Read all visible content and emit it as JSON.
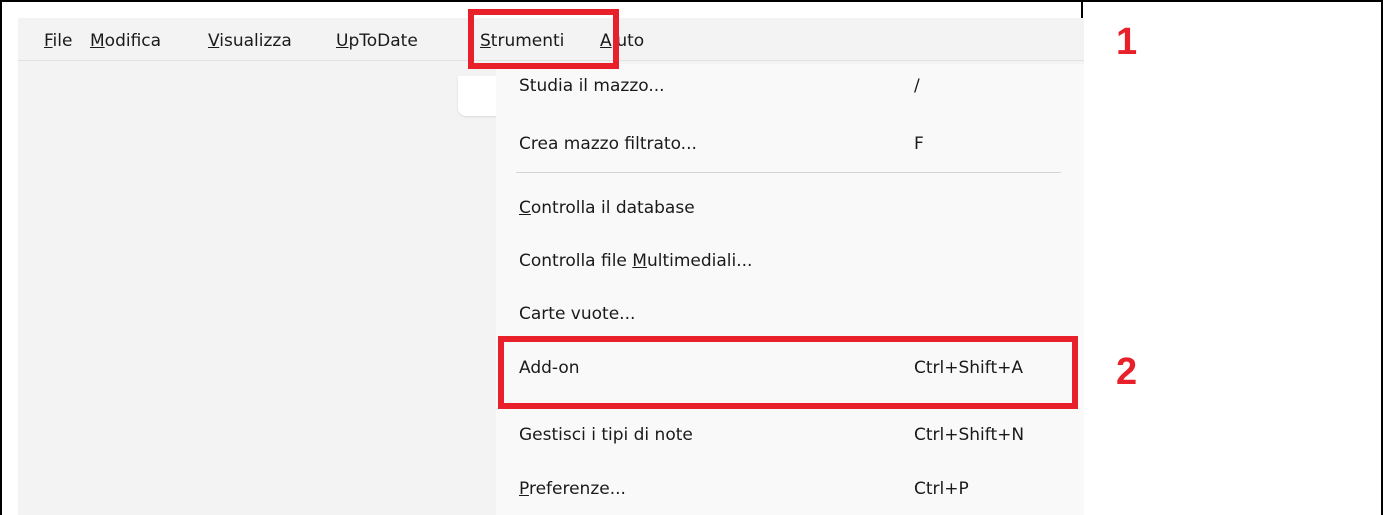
{
  "menubar": {
    "items": [
      {
        "mnemonic": "F",
        "rest": "ile"
      },
      {
        "mnemonic": "M",
        "rest": "odifica"
      },
      {
        "mnemonic": "V",
        "rest": "isualizza"
      },
      {
        "mnemonic": "U",
        "rest": "pToDate"
      },
      {
        "mnemonic": "S",
        "rest": "trumenti"
      },
      {
        "mnemonic": "A",
        "rest": "iuto"
      }
    ]
  },
  "dropdown": {
    "items": [
      {
        "label": "Studia il mazzo...",
        "shortcut": "/"
      },
      {
        "label": "Crea mazzo filtrato...",
        "shortcut": "F"
      },
      {
        "pre": "",
        "mnemonic": "C",
        "post": "ontrolla il database",
        "shortcut": ""
      },
      {
        "pre": "Controlla file ",
        "mnemonic": "M",
        "post": "ultimediali...",
        "shortcut": ""
      },
      {
        "label": "Carte vuote...",
        "shortcut": ""
      },
      {
        "label": "Add-on",
        "shortcut": "Ctrl+Shift+A"
      },
      {
        "label": "Gestisci i tipi di note",
        "shortcut": "Ctrl+Shift+N"
      },
      {
        "pre": "",
        "mnemonic": "P",
        "post": "referenze...",
        "shortcut": "Ctrl+P"
      }
    ]
  },
  "annotations": {
    "step1": "1",
    "step2": "2",
    "highlight_color": "#e8202a"
  }
}
